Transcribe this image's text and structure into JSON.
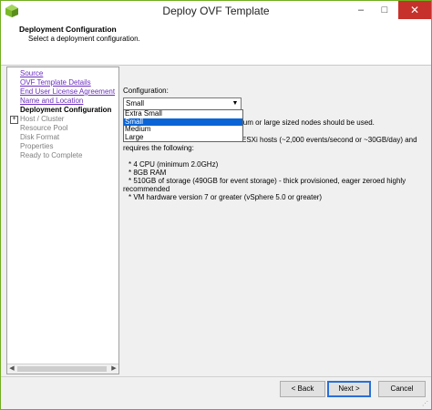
{
  "window": {
    "title": "Deploy OVF Template",
    "minimize": "–",
    "maximize": "□",
    "close": "✕"
  },
  "header": {
    "title": "Deployment Configuration",
    "subtitle": "Select a deployment configuration."
  },
  "nav": {
    "items": [
      {
        "label": "Source",
        "state": "link"
      },
      {
        "label": "OVF Template Details",
        "state": "link"
      },
      {
        "label": "End User License Agreement",
        "state": "link"
      },
      {
        "label": "Name and Location",
        "state": "link"
      },
      {
        "label": "Deployment Configuration",
        "state": "current"
      },
      {
        "label": "Host / Cluster",
        "state": "disabled"
      },
      {
        "label": "Resource Pool",
        "state": "disabled"
      },
      {
        "label": "Disk Format",
        "state": "disabled"
      },
      {
        "label": "Properties",
        "state": "disabled"
      },
      {
        "label": "Ready to Complete",
        "state": "disabled"
      }
    ],
    "expander": "+"
  },
  "content": {
    "config_label": "Configuration:",
    "selected": "Small",
    "options": [
      "Extra Small",
      "Small",
      "Medium",
      "Large"
    ],
    "line1_tail": "ium or large sized nodes should be used.",
    "line2_tail": "ESXi hosts (~2,000 events/second or ~30GB/day) and",
    "line3": "requires the following:",
    "bullets": [
      "* 4 CPU (minimum 2.0GHz)",
      "* 8GB RAM",
      "* 510GB of storage (490GB for event storage) - thick provisioned, eager zeroed highly",
      "recommended",
      "* VM hardware version 7 or greater (vSphere 5.0 or greater)"
    ]
  },
  "footer": {
    "back": "< Back",
    "next": "Next >",
    "cancel": "Cancel"
  },
  "colors": {
    "accent_border": "#6fae1f",
    "link": "#6b2fbf",
    "selection": "#0a64d6"
  }
}
